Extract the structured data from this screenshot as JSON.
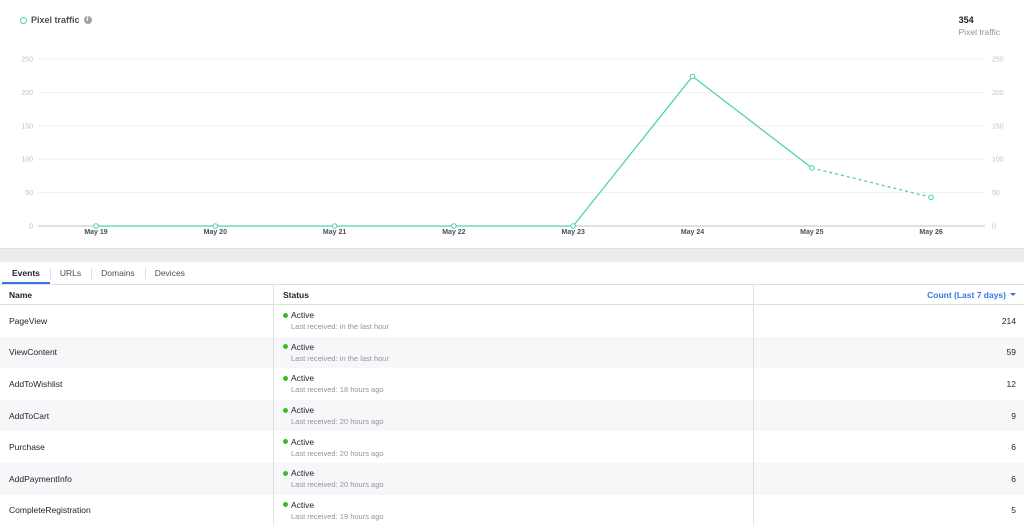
{
  "chart_card": {
    "legend_label": "Pixel traffic",
    "info_icon": "info-icon",
    "total_value": "354",
    "total_label": "Pixel traffic"
  },
  "chart_data": {
    "type": "line",
    "categories": [
      "May 19",
      "May 20",
      "May 21",
      "May 22",
      "May 23",
      "May 24",
      "May 25",
      "May 26"
    ],
    "series": [
      {
        "name": "Pixel traffic",
        "values": [
          0,
          0,
          0,
          0,
          0,
          224,
          87,
          43
        ],
        "color": "#4fd1b2",
        "dashed_from_index": 6
      }
    ],
    "y_ticks": [
      "0",
      "50",
      "100",
      "150",
      "200",
      "250"
    ],
    "ylim": [
      0,
      250
    ],
    "grid": true,
    "title": "",
    "xlabel": "",
    "ylabel": ""
  },
  "tabs": [
    "Events",
    "URLs",
    "Domains",
    "Devices"
  ],
  "table": {
    "headers": {
      "name": "Name",
      "status": "Status",
      "count": "Count (Last 7 days)"
    },
    "rows": [
      {
        "name": "PageView",
        "status": "Active",
        "last": "Last received: in the last hour",
        "count": "214"
      },
      {
        "name": "ViewContent",
        "status": "Active",
        "last": "Last received: in the last hour",
        "count": "59"
      },
      {
        "name": "AddToWishlist",
        "status": "Active",
        "last": "Last received: 18 hours ago",
        "count": "12"
      },
      {
        "name": "AddToCart",
        "status": "Active",
        "last": "Last received: 20 hours ago",
        "count": "9"
      },
      {
        "name": "Purchase",
        "status": "Active",
        "last": "Last received: 20 hours ago",
        "count": "6"
      },
      {
        "name": "AddPaymentInfo",
        "status": "Active",
        "last": "Last received: 20 hours ago",
        "count": "6"
      },
      {
        "name": "CompleteRegistration",
        "status": "Active",
        "last": "Last received: 19 hours ago",
        "count": "5"
      }
    ]
  },
  "colors": {
    "accent": "#3578e5",
    "line": "#4fd1b2",
    "active": "#42b72a"
  }
}
